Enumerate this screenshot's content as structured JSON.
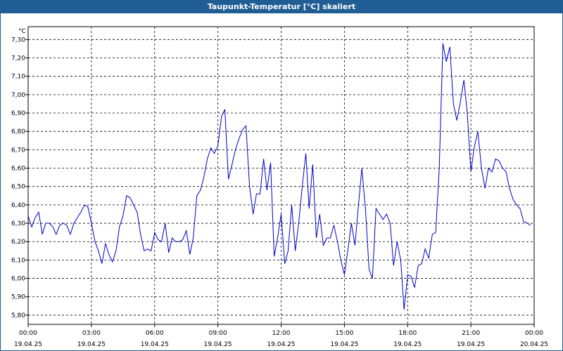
{
  "window": {
    "title": "Taupunkt-Temperatur [°C] skaliert"
  },
  "colors": {
    "titlebar": "#1f5d94",
    "line": "#0000cc",
    "grid": "#000000"
  },
  "chart_data": {
    "type": "line",
    "title": "Taupunkt-Temperatur [°C] skaliert",
    "ylabel": "°C",
    "ylim": [
      5.75,
      7.37
    ],
    "grid": true,
    "legend": "none",
    "y_ticks": [
      "5,80",
      "5,90",
      "6,00",
      "6,10",
      "6,20",
      "6,30",
      "6,40",
      "6,50",
      "6,60",
      "6,70",
      "6,80",
      "6,90",
      "7,00",
      "7,10",
      "7,20",
      "7,30"
    ],
    "y_tick_values": [
      5.8,
      5.9,
      6.0,
      6.1,
      6.2,
      6.3,
      6.4,
      6.5,
      6.6,
      6.7,
      6.8,
      6.9,
      7.0,
      7.1,
      7.2,
      7.3
    ],
    "x_range_hours": [
      0,
      24
    ],
    "x_ticks": [
      {
        "time": "00:00",
        "date": "19.04.25"
      },
      {
        "time": "03:00",
        "date": "19.04.25"
      },
      {
        "time": "06:00",
        "date": "19.04.25"
      },
      {
        "time": "09:00",
        "date": "19.04.25"
      },
      {
        "time": "12:00",
        "date": "19.04.25"
      },
      {
        "time": "15:00",
        "date": "19.04.25"
      },
      {
        "time": "18:00",
        "date": "19.04.25"
      },
      {
        "time": "21:00",
        "date": "19.04.25"
      },
      {
        "time": "00:00",
        "date": "20.04.25"
      }
    ],
    "series": [
      {
        "x_hours": [
          0,
          0.17,
          0.33,
          0.5,
          0.67,
          0.83,
          1.0,
          1.17,
          1.33,
          1.5,
          1.67,
          1.83,
          2.0,
          2.17,
          2.33,
          2.5,
          2.67,
          2.83,
          3.0,
          3.17,
          3.33,
          3.5,
          3.67,
          3.83,
          4.0,
          4.17,
          4.33,
          4.5,
          4.67,
          4.83,
          5.0,
          5.17,
          5.33,
          5.5,
          5.67,
          5.83,
          6.0,
          6.17,
          6.33,
          6.5,
          6.67,
          6.83,
          7.0,
          7.17,
          7.33,
          7.5,
          7.67,
          7.83,
          8.0,
          8.17,
          8.33,
          8.5,
          8.67,
          8.83,
          9.0,
          9.17,
          9.33,
          9.5,
          9.67,
          9.83,
          10.0,
          10.17,
          10.33,
          10.5,
          10.67,
          10.83,
          11.0,
          11.17,
          11.33,
          11.5,
          11.67,
          11.83,
          12.0,
          12.17,
          12.33,
          12.5,
          12.67,
          12.83,
          13.0,
          13.17,
          13.33,
          13.5,
          13.67,
          13.83,
          14.0,
          14.17,
          14.33,
          14.5,
          14.67,
          14.83,
          15.0,
          15.17,
          15.33,
          15.5,
          15.67,
          15.83,
          16.0,
          16.17,
          16.33,
          16.5,
          16.67,
          16.83,
          17.0,
          17.17,
          17.33,
          17.5,
          17.67,
          17.83,
          18.0,
          18.17,
          18.33,
          18.5,
          18.67,
          18.83,
          19.0,
          19.17,
          19.33,
          19.5,
          19.67,
          19.83,
          20.0,
          20.17,
          20.33,
          20.5,
          20.67,
          20.83,
          21.0,
          21.17,
          21.33,
          21.5,
          21.67,
          21.83,
          22.0,
          22.17,
          22.33,
          22.5,
          22.67,
          22.83,
          23.0,
          23.17,
          23.33,
          23.5,
          23.67,
          23.83
        ],
        "y": [
          6.34,
          6.28,
          6.33,
          6.36,
          6.24,
          6.3,
          6.3,
          6.28,
          6.24,
          6.29,
          6.3,
          6.29,
          6.24,
          6.3,
          6.33,
          6.36,
          6.4,
          6.39,
          6.3,
          6.2,
          6.15,
          6.08,
          6.19,
          6.13,
          6.09,
          6.15,
          6.28,
          6.34,
          6.45,
          6.44,
          6.4,
          6.36,
          6.24,
          6.15,
          6.16,
          6.15,
          6.25,
          6.21,
          6.2,
          6.3,
          6.14,
          6.22,
          6.2,
          6.2,
          6.21,
          6.26,
          6.13,
          6.22,
          6.45,
          6.48,
          6.55,
          6.65,
          6.71,
          6.68,
          6.72,
          6.88,
          6.92,
          6.54,
          6.62,
          6.7,
          6.76,
          6.81,
          6.83,
          6.5,
          6.35,
          6.46,
          6.46,
          6.65,
          6.48,
          6.63,
          6.12,
          6.22,
          6.35,
          6.08,
          6.15,
          6.4,
          6.15,
          6.3,
          6.5,
          6.68,
          6.38,
          6.62,
          6.22,
          6.35,
          6.18,
          6.22,
          6.22,
          6.29,
          6.2,
          6.1,
          6.02,
          6.16,
          6.3,
          6.18,
          6.4,
          6.6,
          6.38,
          6.05,
          6.0,
          6.38,
          6.35,
          6.32,
          6.35,
          6.3,
          6.07,
          6.2,
          6.1,
          5.83,
          6.02,
          6.01,
          5.95,
          6.07,
          6.08,
          6.16,
          6.11,
          6.24,
          6.25,
          6.6,
          7.28,
          7.18,
          7.26,
          6.95,
          6.86,
          6.96,
          7.08,
          6.9,
          6.58,
          6.72,
          6.8,
          6.6,
          6.49,
          6.6,
          6.58,
          6.65,
          6.64,
          6.6,
          6.58,
          6.49,
          6.43,
          6.4,
          6.38,
          6.31,
          6.3,
          6.29,
          6.23
        ]
      }
    ]
  }
}
